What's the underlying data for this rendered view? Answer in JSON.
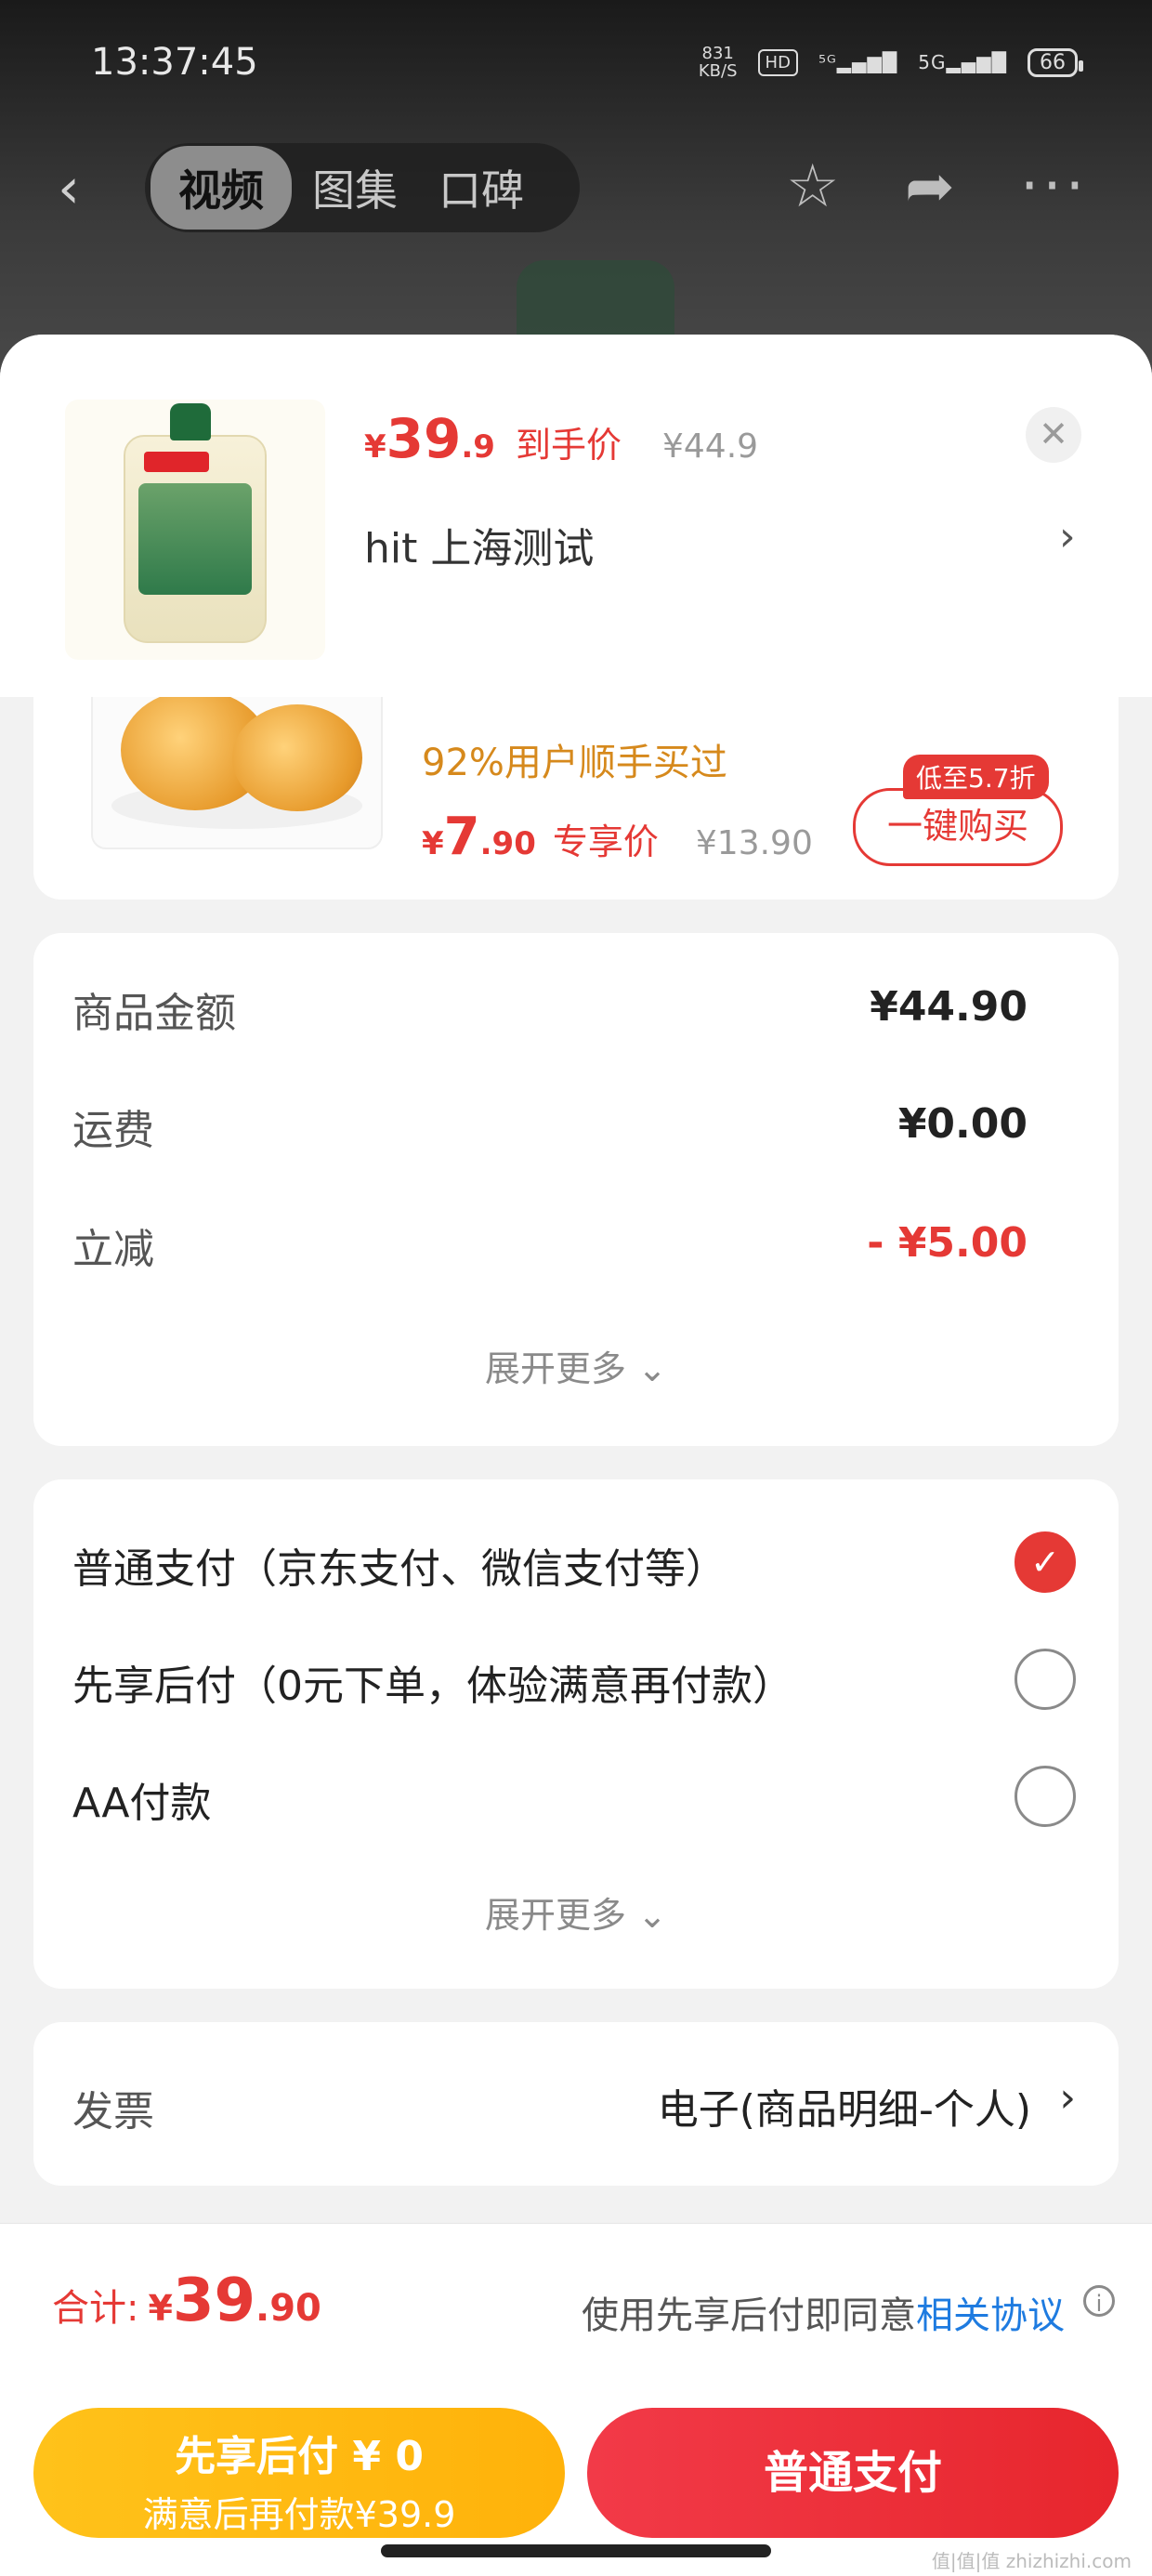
{
  "status_bar": {
    "time": "13:37:45",
    "net_speed": "831",
    "net_unit": "KB/S",
    "hd": "HD",
    "sig1": "⁵ᴳ",
    "sig2": "5G",
    "battery": "66"
  },
  "nav": {
    "tabs": [
      "视频",
      "图集",
      "口碑"
    ],
    "active_tab": "视频"
  },
  "product": {
    "price_yen": "¥",
    "price_int": "39",
    "price_dec": ".9",
    "price_tag": "到手价",
    "original_price": "¥44.9",
    "address": "hit  上海测试"
  },
  "recommend": {
    "hint": "92%用户顺手买过",
    "price_yen": "¥",
    "price_int": "7",
    "price_dec": ".90",
    "price_tag": "专享价",
    "original_price": "¥13.90",
    "badge": "低至5.7折",
    "buy_label": "一键购买"
  },
  "amounts": {
    "rows": [
      {
        "label": "商品金额",
        "value": "¥44.90"
      },
      {
        "label": "运费",
        "value": "¥0.00"
      },
      {
        "label": "立减",
        "value": "- ¥5.00"
      }
    ],
    "expand": "展开更多 ⌄"
  },
  "payment": {
    "options": [
      {
        "label": "普通支付（京东支付、微信支付等）",
        "selected": true
      },
      {
        "label": "先享后付（0元下单，体验满意再付款）",
        "selected": false
      },
      {
        "label": "AA付款",
        "selected": false
      }
    ],
    "expand": "展开更多 ⌄"
  },
  "invoice": {
    "label": "发票",
    "value": "电子(商品明细-个人)"
  },
  "footer": {
    "total_label": "合计:",
    "total_yen": "¥",
    "total_int": "39",
    "total_dec": ".90",
    "agree_text": "使用先享后付即同意",
    "agree_link": "相关协议",
    "btn_after_l1": "先享后付 ¥ 0",
    "btn_after_l2": "满意后再付款¥39.9",
    "btn_normal": "普通支付"
  },
  "watermark": "值|值|值 zhizhizhi.com",
  "colors": {
    "accent_red": "#e53935",
    "link_blue": "#1e7be0",
    "yellow": "#ffb20a"
  }
}
